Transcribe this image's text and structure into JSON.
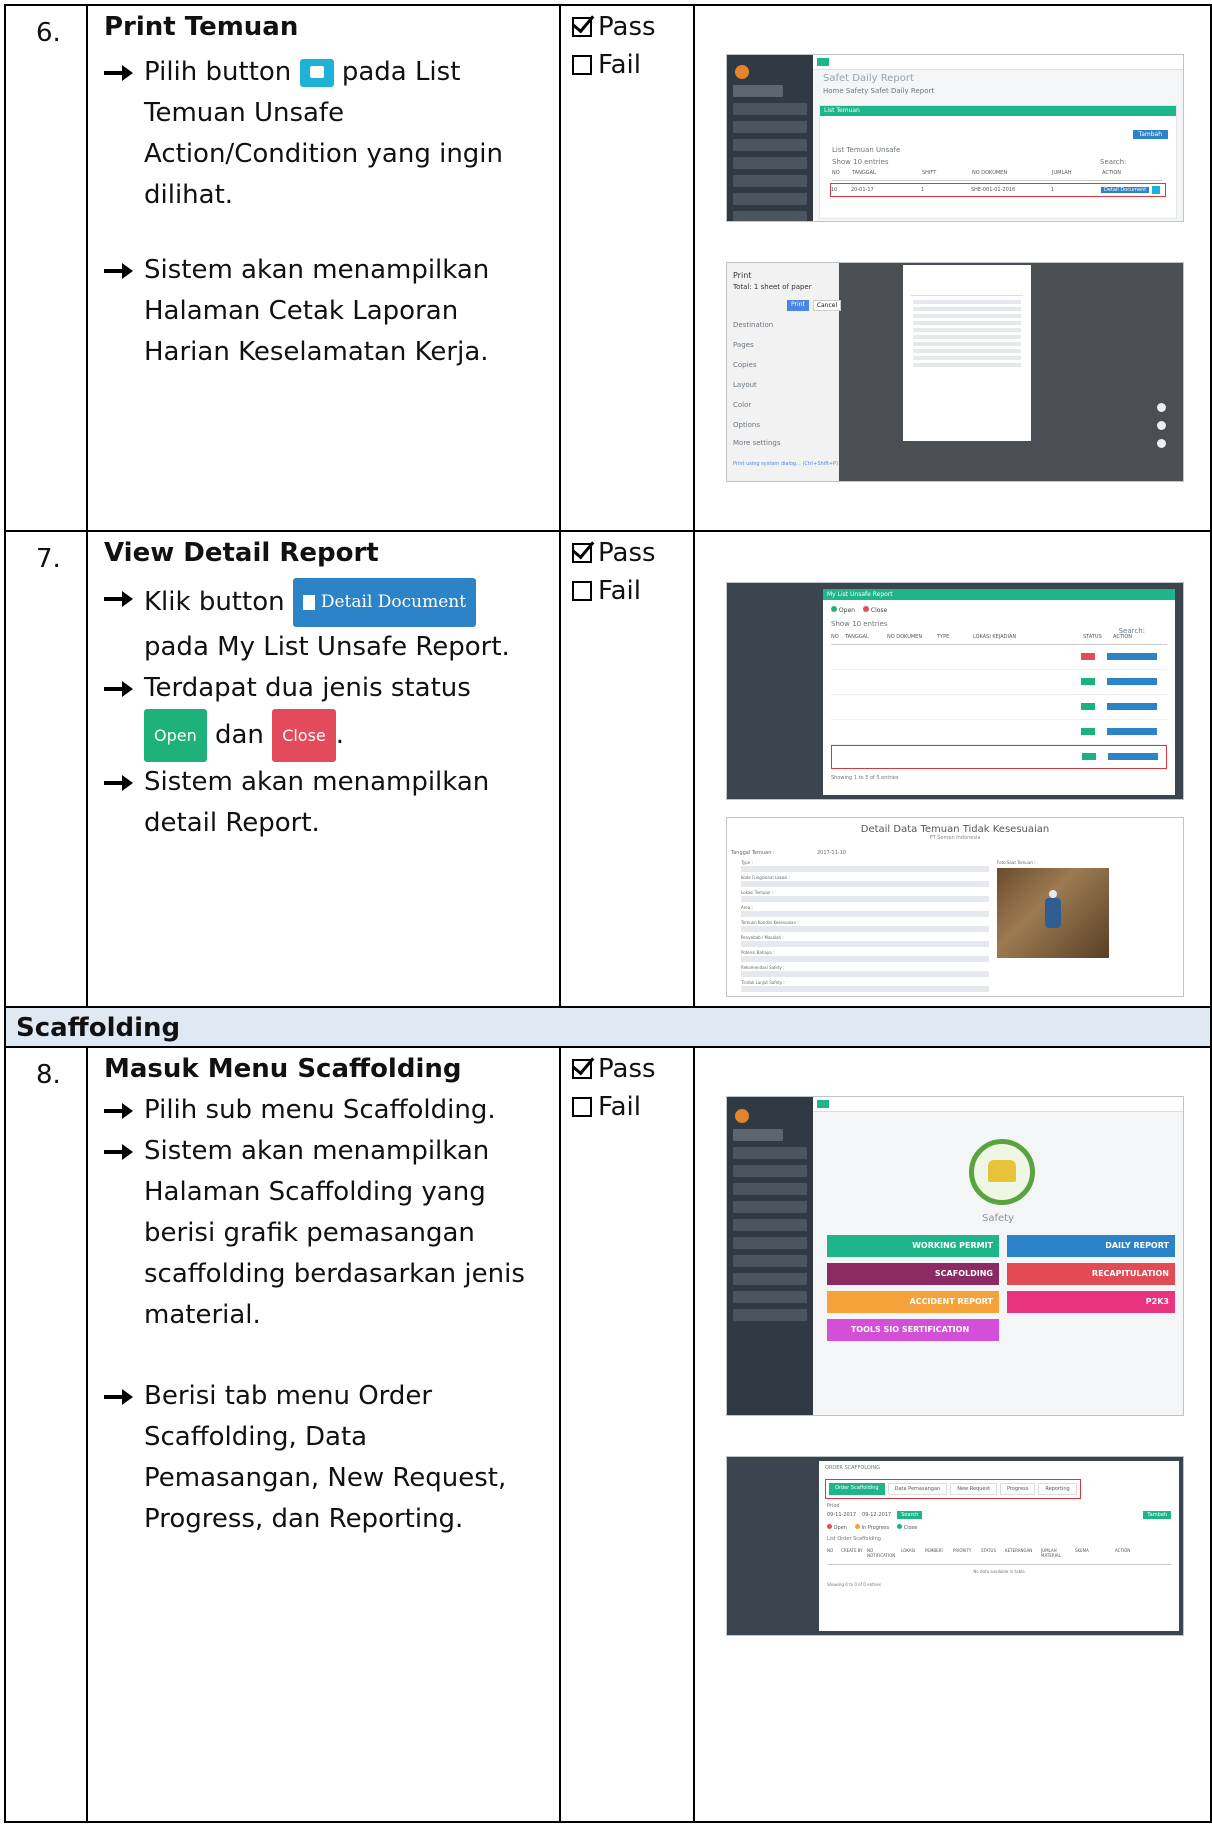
{
  "rows": [
    {
      "number": "6.",
      "title": "Print Temuan",
      "step1_before": "Pilih button",
      "step1_after": "pada List Temuan Unsafe Action/Condition yang ingin dilihat.",
      "step2": "Sistem akan menampilkan Halaman Cetak Laporan Harian Keselamatan Kerja.",
      "pass": "Pass",
      "fail": "Fail",
      "shot1": {
        "title": "Safet Daily Report",
        "breadcrumb": "Home  Safety  Safet Daily Report",
        "panel": "List Temuan",
        "button": "Tambah",
        "table_caption": "List Temuan Unsafe",
        "show": "Show 10 entries",
        "search": "Search:",
        "headers": [
          "NO",
          "TANGGAL",
          "SHIFT",
          "NO DOKUMEN",
          "JUMLAH",
          "ACTION"
        ],
        "cells": [
          "10",
          "20-01-17",
          "1",
          "SHE-001-01-2016",
          "1"
        ],
        "action_label": "Detail Document"
      },
      "shot2": {
        "dialog_title": "Print",
        "total": "Total: 1 sheet of paper",
        "print_btn": "Print",
        "cancel_btn": "Cancel",
        "fields": [
          "Destination",
          "Pages",
          "Copies",
          "Layout",
          "Color",
          "Options"
        ],
        "options_link": "More settings",
        "footer": "Print using system dialog... (Ctrl+Shift+P)"
      }
    },
    {
      "number": "7.",
      "title": "View Detail Report",
      "step1": "Klik button",
      "detail_btn": "Detail Document",
      "step1_after": "pada My List Unsafe Report.",
      "step2": "Terdapat dua jenis status",
      "open_btn": "Open",
      "dan": "dan",
      "close_btn": "Close",
      "period": ".",
      "step3": "Sistem akan menampilkan detail Report.",
      "pass": "Pass",
      "fail": "Fail",
      "shot1": {
        "header": "My List Unsafe Report",
        "legend": [
          "Open",
          "Close"
        ],
        "show": "Show 10 entries",
        "search": "Search:",
        "headers": [
          "NO",
          "TANGGAL",
          "NO DOKUMEN",
          "TYPE",
          "LOKASI KEJADIAN",
          "STATUS",
          "ACTION"
        ],
        "footer": "Showing 1 to 5 of 5 entries"
      },
      "shot2": {
        "title": "Detail Data Temuan Tidak Kesesuaian",
        "subtitle": "PT Semen Indonesia",
        "date_label": "Tanggal Temuan :",
        "date_value": "2017-11-10",
        "labels": [
          "Type :",
          "Kode Fungsional Lokasi :",
          "Lokasi Temuan :",
          "Area :",
          "Temuan Kondisi Kesesuaian :",
          "Penyebab / Masalah :",
          "Potensi Bahaya :",
          "Rekomendasi Safety :",
          "Tindak Lanjut Safety :"
        ],
        "photo_label": "Foto Saat Temuan :"
      }
    },
    {
      "number": "8.",
      "title": "Masuk Menu Scaffolding",
      "step1": "Pilih sub menu Scaffolding.",
      "step2": "Sistem akan menampilkan Halaman Scaffolding yang berisi grafik pemasangan scaffolding berdasarkan jenis material.",
      "step3": "Berisi tab menu Order Scaffolding, Data Pemasangan, New Request, Progress, dan Reporting.",
      "pass": "Pass",
      "fail": "Fail",
      "shot1": {
        "app_label": "Safety",
        "tiles": [
          "WORKING PERMIT",
          "DAILY REPORT",
          "SCAFOLDING",
          "RECAPITULATION",
          "ACCIDENT REPORT",
          "P2K3",
          "TOOLS SIO SERTIFICATION"
        ]
      },
      "shot2": {
        "header": "ORDER SCAFFOLDING",
        "tabs": [
          "Order Scaffolding",
          "Data Pemasangan",
          "New Request",
          "Progress",
          "Reporting"
        ],
        "period": "Priod",
        "date_from": "09-11-2017",
        "date_to": "09-12-2017",
        "search_btn": "Search",
        "add_btn": "Tambah",
        "legend": [
          "Open",
          "In Progress",
          "Close"
        ],
        "list": "List Order Scaffolding",
        "headers": [
          "NO",
          "CREATE BY",
          "NO NOTIFICATION",
          "LOKASI",
          "PEMBERI",
          "PRIORITY",
          "STATUS",
          "KETERANGAN",
          "JUMLAH MATERIAL",
          "SKEMA",
          "ACTION"
        ],
        "empty": "No data available in table",
        "footer": "Showing 0 to 0 of 0 entries"
      }
    }
  ],
  "section": "Scaffolding",
  "colors": {
    "band": "#dfe9f3",
    "teal": "#1fb58a",
    "blue": "#2d83c7",
    "red": "#e34a5c",
    "sidebar": "#2f3a45"
  }
}
